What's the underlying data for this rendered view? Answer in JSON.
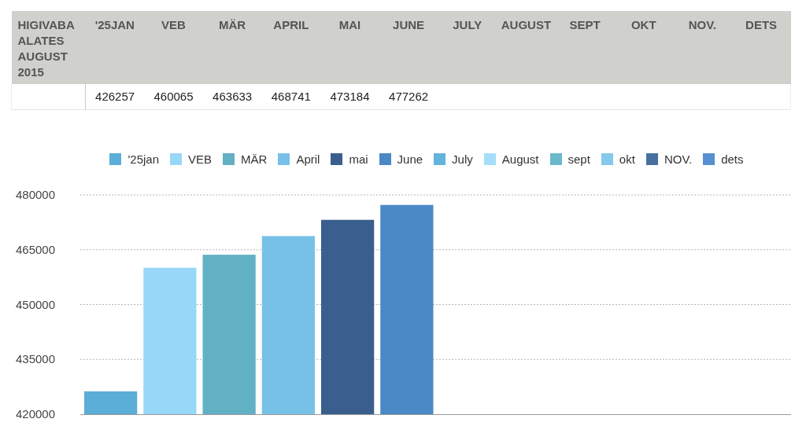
{
  "table": {
    "columns": [
      "HIGIVABA ALATES AUGUST 2015",
      "'25JAN",
      "VEB",
      "MÄR",
      "APRIL",
      "MAI",
      "JUNE",
      "JULY",
      "AUGUST",
      "SEPT",
      "OKT",
      "NOV.",
      "DETS"
    ],
    "rows": [
      [
        "",
        "426257",
        "460065",
        "463633",
        "468741",
        "473184",
        "477262",
        "",
        "",
        "",
        "",
        "",
        ""
      ]
    ]
  },
  "chart": {
    "chart_data": {
      "type": "bar",
      "grid": true,
      "ylim": [
        420000,
        480000
      ],
      "yticks": [
        420000,
        435000,
        450000,
        465000,
        480000
      ],
      "series": [
        {
          "name": "'25jan",
          "color": "#5aaed8",
          "values": [
            426257
          ]
        },
        {
          "name": "VEB",
          "color": "#97d8f8",
          "values": [
            460065
          ]
        },
        {
          "name": "MÄR",
          "color": "#62b0c4",
          "values": [
            463633
          ]
        },
        {
          "name": "April",
          "color": "#77c1e8",
          "values": [
            468741
          ]
        },
        {
          "name": "mai",
          "color": "#3a5f8e",
          "values": [
            473184
          ]
        },
        {
          "name": "June",
          "color": "#4b88c6",
          "values": [
            477262
          ]
        },
        {
          "name": "July",
          "color": "#62b4dd",
          "values": [
            null
          ]
        },
        {
          "name": "August",
          "color": "#a4def8",
          "values": [
            null
          ]
        },
        {
          "name": "sept",
          "color": "#6ab8cb",
          "values": [
            null
          ]
        },
        {
          "name": "okt",
          "color": "#86c8ee",
          "values": [
            null
          ]
        },
        {
          "name": "NOV.",
          "color": "#46709f",
          "values": [
            null
          ]
        },
        {
          "name": "dets",
          "color": "#5790cf",
          "values": [
            null
          ]
        }
      ]
    }
  }
}
